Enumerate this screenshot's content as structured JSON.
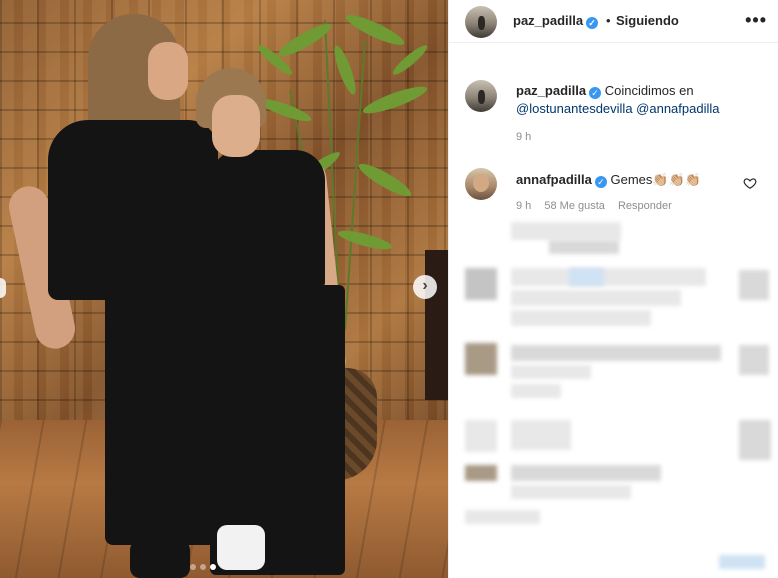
{
  "header": {
    "username": "paz_padilla",
    "separator": "•",
    "follow_status": "Siguiendo",
    "more": "•••"
  },
  "post": {
    "carousel_count": 3,
    "carousel_active": 3,
    "next_icon": "›"
  },
  "caption": {
    "username": "paz_padilla",
    "text": "Coincidimos en",
    "mention_1": "@lostunantesdevilla",
    "mention_2": "@annafpadilla",
    "time": "9 h"
  },
  "comment": {
    "username": "annafpadilla",
    "text": "Gemes👏🏼👏🏼👏🏼",
    "time": "9 h",
    "likes": "58 Me gusta",
    "reply": "Responder"
  },
  "colors": {
    "verified": "#3897f0",
    "link": "#00376b",
    "muted": "#8e8e8e"
  }
}
